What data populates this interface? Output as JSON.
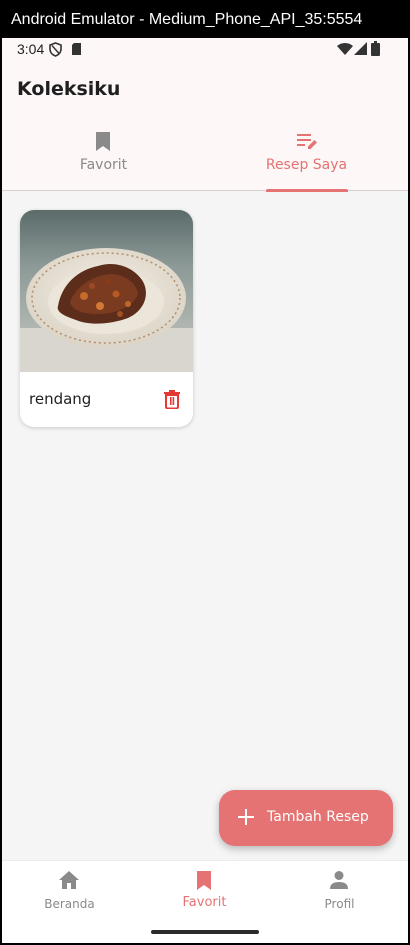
{
  "window": {
    "title": "Android Emulator - Medium_Phone_API_35:5554"
  },
  "status_bar": {
    "time": "3:04",
    "icons": [
      "shield-icon",
      "sim-card-icon",
      "wifi-icon",
      "signal-icon",
      "battery-icon"
    ]
  },
  "app_bar": {
    "title": "Koleksiku"
  },
  "tabs": [
    {
      "label": "Favorit",
      "icon": "bookmark-icon",
      "active": false
    },
    {
      "label": "Resep Saya",
      "icon": "edit-list-icon",
      "active": true
    }
  ],
  "recipes": [
    {
      "name": "rendang",
      "image": "rendang-dish-photo",
      "action_icon": "delete-icon"
    }
  ],
  "fab": {
    "label": "Tambah Resep",
    "icon": "plus-icon"
  },
  "bottom_nav": [
    {
      "label": "Beranda",
      "icon": "home-icon",
      "active": false
    },
    {
      "label": "Favorit",
      "icon": "bookmark-icon",
      "active": true
    },
    {
      "label": "Profil",
      "icon": "person-icon",
      "active": false
    }
  ],
  "colors": {
    "accent": "#e57373",
    "app_bar_bg": "#fdf7f7",
    "content_bg": "#f5f5f5",
    "inactive": "#8a8a8a"
  }
}
